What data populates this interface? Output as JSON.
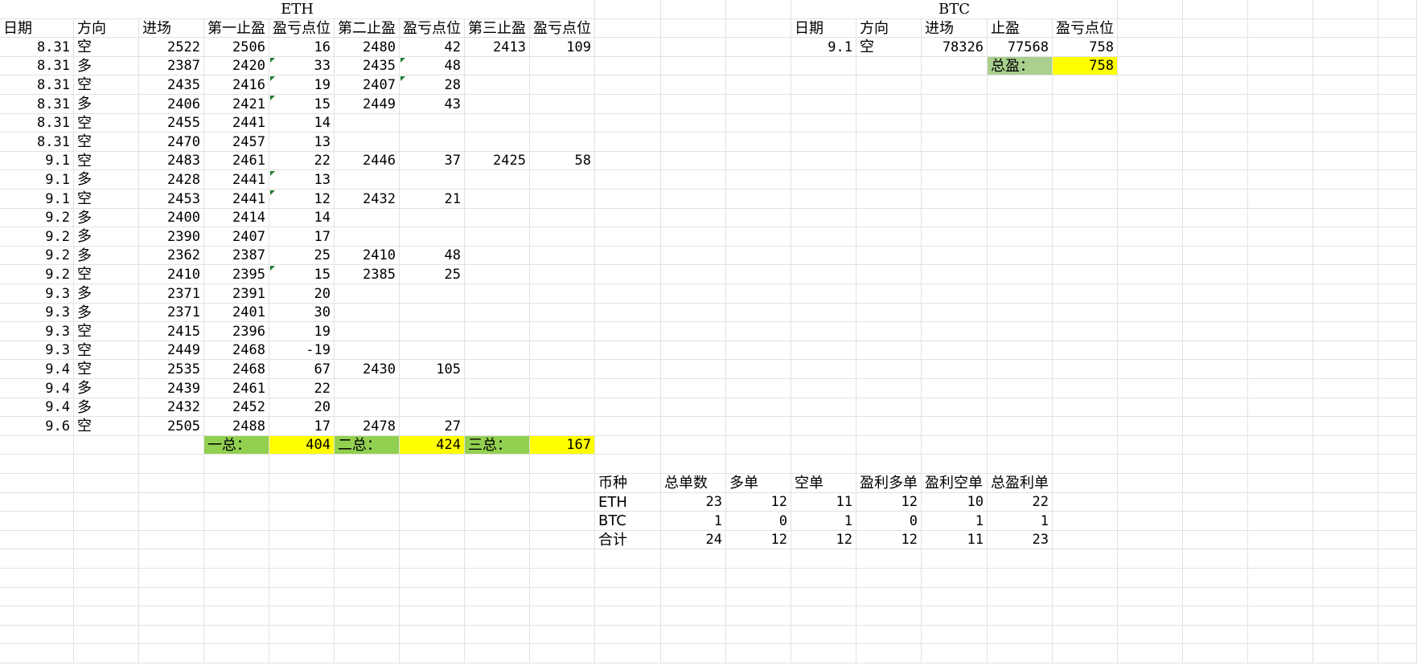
{
  "eth": {
    "title": "ETH",
    "headers": [
      "日期",
      "方向",
      "进场",
      "第一止盈",
      "盈亏点位",
      "第二止盈",
      "盈亏点位",
      "第三止盈",
      "盈亏点位"
    ],
    "rows": [
      [
        "8.31",
        "空",
        "2522",
        "2506",
        "16",
        "2480",
        "42",
        "2413",
        "109"
      ],
      [
        "8.31",
        "多",
        "2387",
        "2420",
        "33",
        "2435",
        "48",
        "",
        ""
      ],
      [
        "8.31",
        "空",
        "2435",
        "2416",
        "19",
        "2407",
        "28",
        "",
        ""
      ],
      [
        "8.31",
        "多",
        "2406",
        "2421",
        "15",
        "2449",
        "43",
        "",
        ""
      ],
      [
        "8.31",
        "空",
        "2455",
        "2441",
        "14",
        "",
        "",
        "",
        ""
      ],
      [
        "8.31",
        "空",
        "2470",
        "2457",
        "13",
        "",
        "",
        "",
        ""
      ],
      [
        "9.1",
        "空",
        "2483",
        "2461",
        "22",
        "2446",
        "37",
        "2425",
        "58"
      ],
      [
        "9.1",
        "多",
        "2428",
        "2441",
        "13",
        "",
        "",
        "",
        ""
      ],
      [
        "9.1",
        "空",
        "2453",
        "2441",
        "12",
        "2432",
        "21",
        "",
        ""
      ],
      [
        "9.2",
        "多",
        "2400",
        "2414",
        "14",
        "",
        "",
        "",
        ""
      ],
      [
        "9.2",
        "多",
        "2390",
        "2407",
        "17",
        "",
        "",
        "",
        ""
      ],
      [
        "9.2",
        "多",
        "2362",
        "2387",
        "25",
        "2410",
        "48",
        "",
        ""
      ],
      [
        "9.2",
        "空",
        "2410",
        "2395",
        "15",
        "2385",
        "25",
        "",
        ""
      ],
      [
        "9.3",
        "多",
        "2371",
        "2391",
        "20",
        "",
        "",
        "",
        ""
      ],
      [
        "9.3",
        "多",
        "2371",
        "2401",
        "30",
        "",
        "",
        "",
        ""
      ],
      [
        "9.3",
        "空",
        "2415",
        "2396",
        "19",
        "",
        "",
        "",
        ""
      ],
      [
        "9.3",
        "空",
        "2449",
        "2468",
        "-19",
        "",
        "",
        "",
        ""
      ],
      [
        "9.4",
        "空",
        "2535",
        "2468",
        "67",
        "2430",
        "105",
        "",
        ""
      ],
      [
        "9.4",
        "多",
        "2439",
        "2461",
        "22",
        "",
        "",
        "",
        ""
      ],
      [
        "9.4",
        "多",
        "2432",
        "2452",
        "20",
        "",
        "",
        "",
        ""
      ],
      [
        "9.6",
        "空",
        "2505",
        "2488",
        "17",
        "2478",
        "27",
        "",
        ""
      ]
    ],
    "totals": {
      "label1": "一总：",
      "value1": "404",
      "label2": "二总：",
      "value2": "424",
      "label3": "三总：",
      "value3": "167"
    }
  },
  "btc": {
    "title": "BTC",
    "headers": [
      "日期",
      "方向",
      "进场",
      "止盈",
      "盈亏点位"
    ],
    "rows": [
      [
        "9.1",
        "空",
        "78326",
        "77568",
        "758"
      ]
    ],
    "total_label": "总盈：",
    "total_value": "758"
  },
  "summary": {
    "headers": [
      "币种",
      "总单数",
      "多单",
      "空单",
      "盈利多单",
      "盈利空单",
      "总盈利单"
    ],
    "rows": [
      [
        "ETH",
        "23",
        "12",
        "11",
        "12",
        "10",
        "22"
      ],
      [
        "BTC",
        "1",
        "0",
        "1",
        "0",
        "1",
        "1"
      ],
      [
        "合计",
        "24",
        "12",
        "12",
        "12",
        "11",
        "23"
      ]
    ]
  },
  "colors": {
    "green": "#92d050",
    "yellow": "#ffff00",
    "light_green": "#a9d08e",
    "gridline": "#e2e2e2"
  }
}
